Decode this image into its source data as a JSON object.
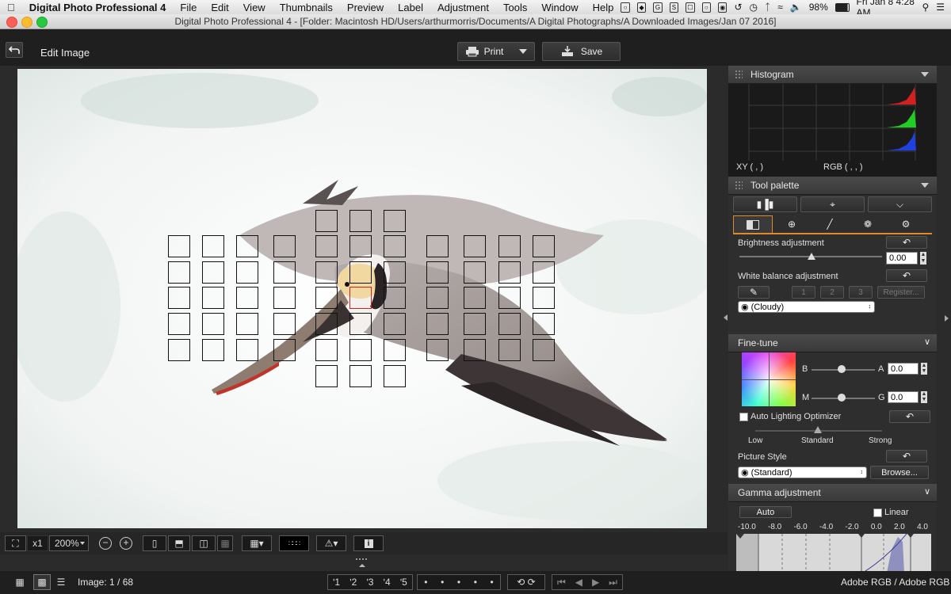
{
  "menubar": {
    "app_name": "Digital Photo Professional 4",
    "items": [
      "File",
      "Edit",
      "View",
      "Thumbnails",
      "Preview",
      "Label",
      "Adjustment",
      "Tools",
      "Window",
      "Help"
    ],
    "battery": "98%",
    "clock": "Fri Jan 8  4:28 AM"
  },
  "window": {
    "title": "Digital Photo Professional 4 - [Folder: Macintosh HD/Users/arthurmorris/Documents/A Digital Photographs/A Downloaded Images/Jan 07 2016]"
  },
  "toolbar": {
    "mode_label": "Edit Image",
    "print_label": "Print",
    "save_label": "Save"
  },
  "histogram": {
    "title": "Histogram",
    "xy_label": "XY (          ,          )",
    "rgb_label": "RGB (          ,          ,          )"
  },
  "tool_palette": {
    "title": "Tool palette",
    "brightness": {
      "label": "Brightness adjustment",
      "value": "0.00"
    },
    "white_balance": {
      "label": "White balance adjustment",
      "register_buttons": [
        "1",
        "2",
        "3"
      ],
      "register_label": "Register...",
      "selected": "(Cloudy)"
    }
  },
  "fine_tune": {
    "title": "Fine-tune",
    "b_label": "B",
    "a_label": "A",
    "a_value": "0.0",
    "m_label": "M",
    "g_label": "G",
    "g_value": "0.0",
    "alo_label": "Auto Lighting Optimizer",
    "alo_levels": [
      "Low",
      "Standard",
      "Strong"
    ],
    "picture_style_label": "Picture Style",
    "picture_style_value": "(Standard)",
    "browse_label": "Browse..."
  },
  "gamma": {
    "title": "Gamma adjustment",
    "auto_label": "Auto",
    "linear_label": "Linear",
    "scale": [
      "-10.0",
      "-8.0",
      "-6.0",
      "-4.0",
      "-2.0",
      "0.0",
      "2.0",
      "4.0"
    ]
  },
  "viewbar": {
    "zoom_x": "x1",
    "zoom_value": "200%"
  },
  "statusbar": {
    "image_count": "Image: 1 / 68",
    "color_space": "Adobe RGB / Adobe RGB",
    "ratings": [
      "ʹ1",
      "ʹ2",
      "ʹ3",
      "ʹ4",
      "ʹ5"
    ]
  },
  "colors": {
    "accent": "#e08a2a",
    "panel_bg": "#2e2e2e",
    "toolbar_bg": "#1f1f1f",
    "af_active": "#d02020"
  }
}
